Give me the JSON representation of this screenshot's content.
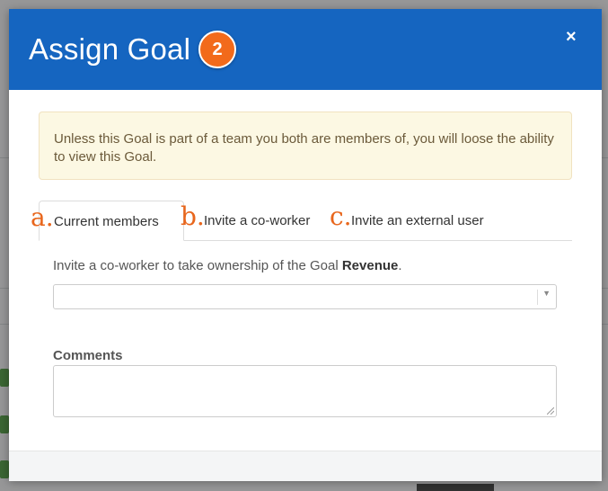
{
  "modal": {
    "title": "Assign Goal",
    "step_number": "2",
    "close_glyph": "×"
  },
  "alert": {
    "text": "Unless this Goal is part of a team you both are members of, you will loose the ability to view this Goal."
  },
  "tabs": [
    {
      "letter": "a.",
      "label": "Current members",
      "active": true
    },
    {
      "letter": "b.",
      "label": "Invite a co-worker",
      "active": false
    },
    {
      "letter": "c.",
      "label": "Invite an external user",
      "active": false
    }
  ],
  "instruction": {
    "prefix": "Invite a co-worker to take ownership of the Goal ",
    "goal_name": "Revenue",
    "suffix": "."
  },
  "coworker_select": {
    "value": "",
    "arrow_glyph": "▼"
  },
  "comments": {
    "label": "Comments",
    "value": ""
  },
  "colors": {
    "header": "#1565c0",
    "badge": "#f26a1b",
    "annotation_letters": "#e8661c",
    "alert_bg": "#fcf8e3"
  },
  "icons": [
    "close-icon",
    "dropdown-arrow-icon",
    "resize-grip-icon"
  ]
}
